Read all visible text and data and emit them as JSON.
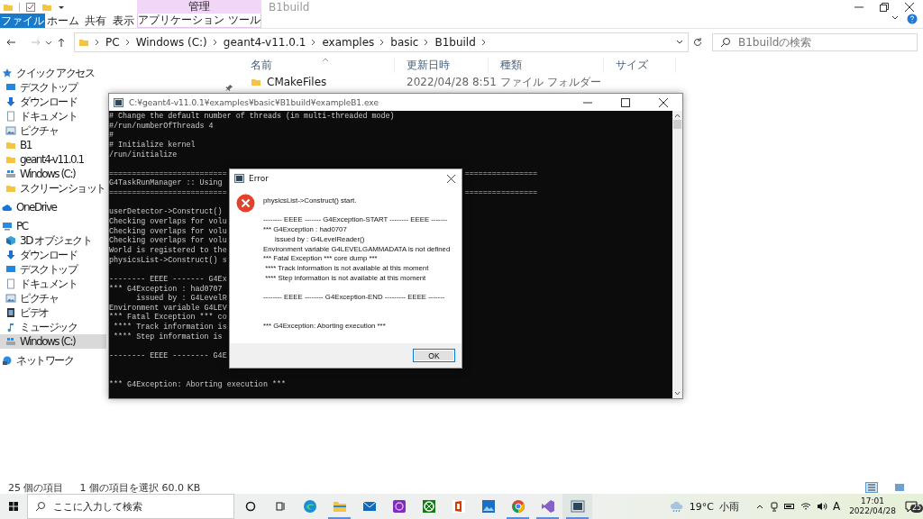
{
  "explorer": {
    "title": "B1build",
    "context_group": "管理",
    "ribbon_tabs": [
      {
        "label": "ファイル",
        "kind": "file"
      },
      {
        "label": "ホーム",
        "kind": "plain"
      },
      {
        "label": "共有",
        "kind": "plain"
      },
      {
        "label": "表示",
        "kind": "plain"
      },
      {
        "label": "アプリケーション ツール",
        "kind": "context"
      }
    ],
    "breadcrumbs": [
      "PC",
      "Windows (C:)",
      "geant4-v11.0.1",
      "examples",
      "basic",
      "B1build"
    ],
    "search": {
      "placeholder": "B1buildの検索"
    },
    "nav": [
      {
        "label": "クイック アクセス",
        "kind": "star",
        "selected": false,
        "children": [
          {
            "label": "デスクトップ",
            "kind": "desktop",
            "selected": false,
            "pinned": true
          },
          {
            "label": "ダウンロード",
            "kind": "download",
            "selected": false
          },
          {
            "label": "ドキュメント",
            "kind": "document",
            "selected": false
          },
          {
            "label": "ピクチャ",
            "kind": "picture",
            "selected": false
          },
          {
            "label": "B1",
            "kind": "folder",
            "selected": false
          },
          {
            "label": "geant4-v11.0.1",
            "kind": "folder",
            "selected": false
          },
          {
            "label": "Windows (C:)",
            "kind": "drive",
            "selected": false
          },
          {
            "label": "スクリーンショット",
            "kind": "folder",
            "selected": false
          }
        ]
      },
      {
        "label": "OneDrive",
        "kind": "cloud",
        "selected": false
      },
      {
        "label": "PC",
        "kind": "pc",
        "selected": false,
        "children": [
          {
            "label": "3D オブジェクト",
            "kind": "cube",
            "selected": false
          },
          {
            "label": "ダウンロード",
            "kind": "download",
            "selected": false
          },
          {
            "label": "デスクトップ",
            "kind": "desktop",
            "selected": false
          },
          {
            "label": "ドキュメント",
            "kind": "document",
            "selected": false
          },
          {
            "label": "ピクチャ",
            "kind": "picture",
            "selected": false
          },
          {
            "label": "ビデオ",
            "kind": "video",
            "selected": false
          },
          {
            "label": "ミュージック",
            "kind": "music",
            "selected": false
          },
          {
            "label": "Windows (C:)",
            "kind": "drive",
            "selected": true
          }
        ]
      },
      {
        "label": "ネットワーク",
        "kind": "network",
        "selected": false
      }
    ],
    "columns": [
      "名前",
      "更新日時",
      "種類",
      "サイズ"
    ],
    "rows": [
      {
        "name": "CMakeFiles",
        "modified": "2022/04/28 8:51",
        "type": "ファイル フォルダー"
      }
    ],
    "status": {
      "count": "25 個の項目",
      "selection": "1 個の項目を選択 60.0 KB"
    }
  },
  "console": {
    "title": "C:¥geant4-v11.0.1¥examples¥basic¥B1build¥exampleB1.exe",
    "lines": [
      {
        "kind": "text",
        "text": "# Change the default number of threads (in multi-threaded mode)"
      },
      {
        "kind": "text",
        "text": "#/run/numberOfThreads 4"
      },
      {
        "kind": "text",
        "text": "#"
      },
      {
        "kind": "text",
        "text": "# Initialize kernel"
      },
      {
        "kind": "text",
        "text": "/run/initialize"
      },
      {
        "kind": "blank"
      },
      {
        "kind": "text",
        "text": "==========================",
        "tail": "================"
      },
      {
        "kind": "text",
        "text": "G4TaskRunManager :: Using"
      },
      {
        "kind": "text",
        "text": "==========================",
        "tail": "================"
      },
      {
        "kind": "blank"
      },
      {
        "kind": "text",
        "text": "userDetector->Construct()"
      },
      {
        "kind": "text",
        "text": "Checking overlaps for volu"
      },
      {
        "kind": "text",
        "text": "Checking overlaps for volu"
      },
      {
        "kind": "text",
        "text": "Checking overlaps for volu"
      },
      {
        "kind": "text",
        "text": "World is registered to the"
      },
      {
        "kind": "text",
        "text": "physicsList->Construct() s"
      },
      {
        "kind": "blank"
      },
      {
        "kind": "text",
        "text": "-------- EEEE ------- G4Ex"
      },
      {
        "kind": "text",
        "text": "*** G4Exception : had0707"
      },
      {
        "kind": "text",
        "text": "      issued by : G4LevelR"
      },
      {
        "kind": "text",
        "text": "Environment variable G4LEV"
      },
      {
        "kind": "text",
        "text": "*** Fatal Exception *** co"
      },
      {
        "kind": "text",
        "text": " **** Track information is"
      },
      {
        "kind": "text",
        "text": " **** Step information is"
      },
      {
        "kind": "blank"
      },
      {
        "kind": "text",
        "text": "-------- EEEE -------- G4E"
      },
      {
        "kind": "blank"
      },
      {
        "kind": "blank"
      },
      {
        "kind": "text",
        "text": "*** G4Exception: Aborting execution ***"
      }
    ]
  },
  "dialog": {
    "title": "Error",
    "paragraphs": [
      [
        "physicsList->Construct() start."
      ],
      [
        "-------- EEEE ------- G4Exception-START -------- EEEE -------",
        "*** G4Exception : had0707",
        "      issued by : G4LevelReader()",
        "Environment variable G4LEVELGAMMADATA is not defined",
        "*** Fatal Exception *** core dump ***",
        " **** Track information is not available at this moment",
        " **** Step information is not available at this moment"
      ],
      [
        "-------- EEEE -------- G4Exception-END --------- EEEE -------"
      ],
      [
        "*** G4Exception: Aborting execution ***"
      ]
    ],
    "button": "OK"
  },
  "taskbar": {
    "search": {
      "placeholder": "ここに入力して検索"
    },
    "apps": [
      {
        "kind": "cortana",
        "running": false,
        "active": false
      },
      {
        "kind": "taskview",
        "running": false,
        "active": false
      },
      {
        "kind": "edge",
        "running": false,
        "active": false
      },
      {
        "kind": "explorer",
        "running": true,
        "active": false
      },
      {
        "kind": "mail",
        "running": false,
        "active": false
      },
      {
        "kind": "paint",
        "running": false,
        "active": false
      },
      {
        "kind": "xbox",
        "running": false,
        "active": false
      },
      {
        "kind": "office",
        "running": false,
        "active": false
      },
      {
        "kind": "photos",
        "running": false,
        "active": false
      },
      {
        "kind": "chrome",
        "running": true,
        "active": false
      },
      {
        "kind": "studio",
        "running": true,
        "active": false
      },
      {
        "kind": "console",
        "running": true,
        "active": true
      }
    ],
    "temperature": "19°C",
    "weather": "小雨",
    "ime": "A",
    "time": "17:01",
    "date": "2022/04/28",
    "notifications": "25"
  }
}
